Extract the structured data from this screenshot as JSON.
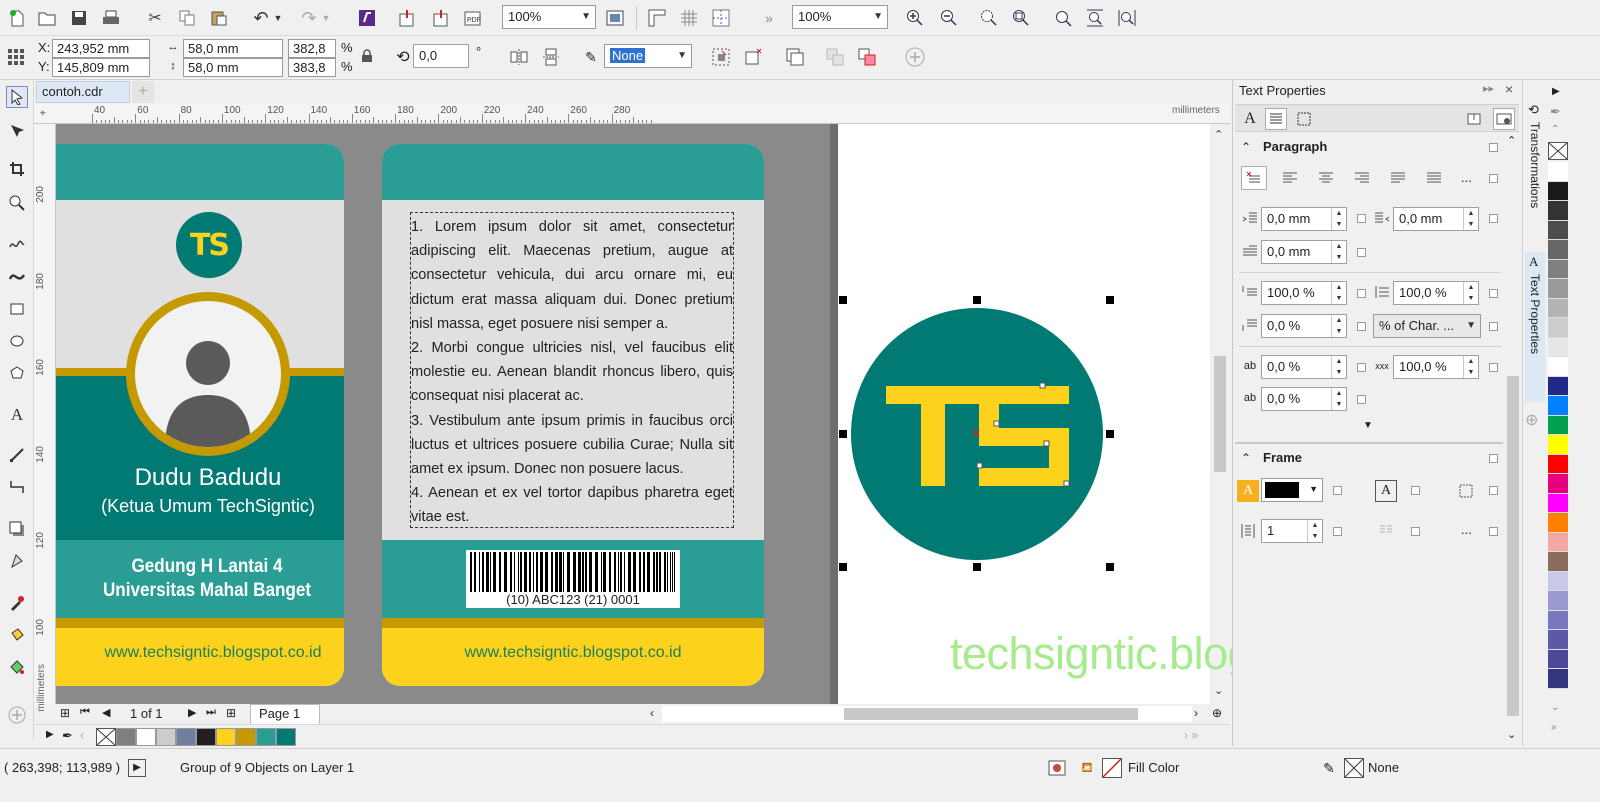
{
  "toolbar": {
    "zoom1": "100%",
    "zoom2": "100%"
  },
  "propbar": {
    "x_label": "X:",
    "y_label": "Y:",
    "x_value": "243,952 mm",
    "y_value": "145,809 mm",
    "w_value": "58,0 mm",
    "h_value": "58,0 mm",
    "w_pct": "382,8",
    "h_pct": "383,8",
    "pct_sign": "%",
    "rotation": "0,0",
    "degree": "°",
    "outline": "None"
  },
  "document": {
    "tab_name": "contoh.cdr",
    "ruler_unit": "millimeters",
    "ruler_ticks_h": [
      "40",
      "60",
      "80",
      "100",
      "120",
      "140",
      "160",
      "180",
      "200",
      "220",
      "240",
      "260",
      "280"
    ],
    "ruler_ticks_v": [
      "200",
      "180",
      "160",
      "140",
      "120",
      "100"
    ],
    "ruler_unit_v": "millimeters"
  },
  "card_front": {
    "logo": "TS",
    "name": "Dudu Badudu",
    "role": "(Ketua Umum TechSigntic)",
    "address1": "Gedung H Lantai 4",
    "address2": "Universitas Mahal Banget",
    "url": "www.techsigntic.blogspot.co.id"
  },
  "card_back": {
    "para1": "1. Lorem ipsum dolor sit amet, consectetur adipiscing elit. Maecenas pretium, augue at consectetur vehicula, dui arcu ornare mi, eu dictum erat massa aliquam dui. Donec pretium nisl massa, eget posuere nisi semper a.",
    "para2": "2. Morbi congue ultricies nisl, vel faucibus elit molestie eu. Aenean blandit rhoncus libero, quis consequat nisi placerat ac.",
    "para3": "3. Vestibulum ante ipsum primis in faucibus orci luctus et ultrices posuere cubilia Curae; Nulla sit amet ex ipsum. Donec non posuere lacus.",
    "para4": "4. Aenean et ex vel tortor dapibus pharetra eget vitae est.",
    "barcode_text": "(10) ABC123 (21) 0001",
    "url": "www.techsigntic.blogspot.co.id"
  },
  "logo_big": "TS",
  "watermark": "techsigntic.blogspot.co.id",
  "pagenav": {
    "page_count": "1 of 1",
    "page_tab": "Page 1"
  },
  "panel": {
    "title": "Text Properties",
    "paragraph": "Paragraph",
    "indent_left": "0,0 mm",
    "indent_right": "0,0 mm",
    "indent_first": "0,0 mm",
    "space_before": "100,0 %",
    "line_spacing": "100,0 %",
    "space_after": "0,0 %",
    "spacing_unit": "% of Char. ...",
    "char_spacing": "0,0 %",
    "word_spacing": "100,0 %",
    "lang_spacing": "0,0 %",
    "frame": "Frame",
    "columns": "1",
    "more": "..."
  },
  "docker_tabs": [
    "Transformations",
    "Text Properties"
  ],
  "statusbar": {
    "coords": "( 263,398; 113,989 )",
    "info": "Group of 9 Objects on Layer 1",
    "fill": "Fill Color",
    "outline": "None"
  },
  "colors": {
    "teal": "#2a9d94",
    "teal_dark": "#007a72",
    "gold": "#c49a00",
    "yellow": "#fcd21d",
    "watermark": "#a7ec8c"
  },
  "palette": [
    "#ffffff",
    "#1a1a1a",
    "#333333",
    "#4d4d4d",
    "#666666",
    "#808080",
    "#999999",
    "#b3b3b3",
    "#cccccc",
    "#e6e6e6",
    "#ffffff",
    "#1f2a8a",
    "#0080ff",
    "#00a050",
    "#ffff00",
    "#ff0000",
    "#e6007e",
    "#ff00ff",
    "#ff8000",
    "#f4a6a0",
    "#8b6b5c",
    "#c8c8e8",
    "#9a9ad0",
    "#7878c0",
    "#5a5aa8",
    "#4a4a98",
    "#353580"
  ],
  "doc_palette": [
    "#7f7f7f",
    "#ffffff",
    "#cccccc",
    "#6f7f9f",
    "#231f20",
    "#fcd21d",
    "#c49a00",
    "#2a9d94",
    "#007a72"
  ]
}
